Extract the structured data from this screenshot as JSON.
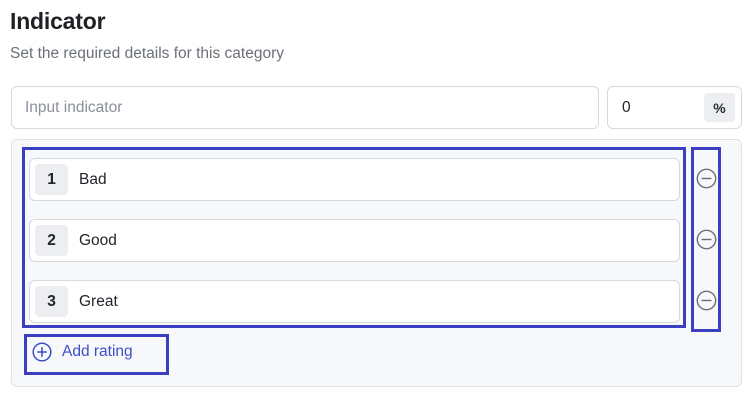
{
  "header": {
    "title": "Indicator",
    "subtitle": "Set the required details for this category"
  },
  "indicator": {
    "placeholder": "Input indicator",
    "value": ""
  },
  "percent": {
    "value": "0",
    "suffix": "%"
  },
  "ratings": [
    {
      "number": "1",
      "label": "Bad"
    },
    {
      "number": "2",
      "label": "Good"
    },
    {
      "number": "3",
      "label": "Great"
    }
  ],
  "add_rating": {
    "label": "Add rating",
    "icon": "plus-circle-icon"
  },
  "remove_icon": "minus-circle-icon",
  "colors": {
    "accent": "#3c4ec9",
    "highlight": "#3b3fbf",
    "panel_bg": "#f7f8fa"
  }
}
